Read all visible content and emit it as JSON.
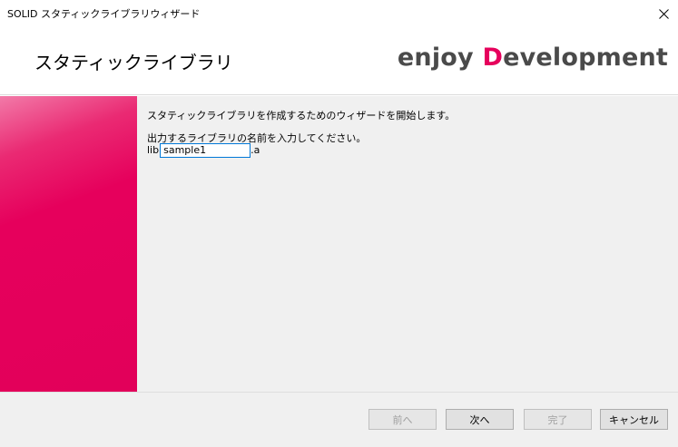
{
  "window": {
    "title": "SOLID スタティックライブラリウィザード"
  },
  "header": {
    "page_title": "スタティックライブラリ",
    "brand_prefix": "enjoy ",
    "brand_accent": "D",
    "brand_suffix": "evelopment",
    "brand_accent_color": "#e6005c"
  },
  "content": {
    "intro": "スタティックライブラリを作成するためのウィザードを開始します。",
    "prompt": "出力するライブラリの名前を入力してください。",
    "lib_prefix": "lib",
    "lib_name": "sample1",
    "lib_suffix": ".a"
  },
  "footer": {
    "back_label": "前へ",
    "next_label": "次へ",
    "finish_label": "完了",
    "cancel_label": "キャンセル"
  },
  "icons": {
    "close": "close-icon"
  }
}
